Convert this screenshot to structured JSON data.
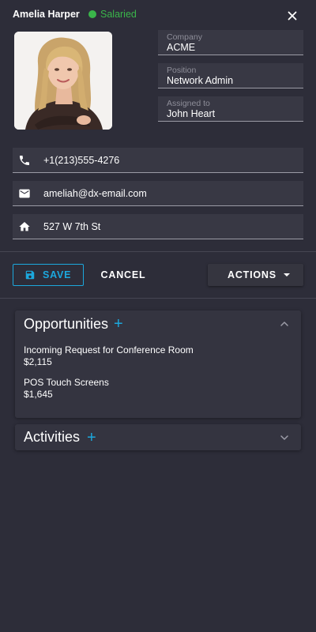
{
  "header": {
    "name": "Amelia Harper",
    "status": "Salaried",
    "status_color": "#3ab54a"
  },
  "photo": {
    "alt": "Amelia Harper photo"
  },
  "fields": {
    "company": {
      "label": "Company",
      "value": "ACME"
    },
    "position": {
      "label": "Position",
      "value": "Network Admin"
    },
    "assigned": {
      "label": "Assigned to",
      "value": "John Heart"
    }
  },
  "contacts": {
    "phone": {
      "icon": "phone-icon",
      "value": "+1(213)555-4276"
    },
    "email": {
      "icon": "email-icon",
      "value": "ameliah@dx-email.com"
    },
    "address": {
      "icon": "home-icon",
      "value": "527 W 7th St"
    }
  },
  "toolbar": {
    "save_label": "SAVE",
    "cancel_label": "CANCEL",
    "actions_label": "ACTIONS"
  },
  "opportunities": {
    "title": "Opportunities",
    "add": "+",
    "items": [
      {
        "name": "Incoming Request for Conference Room",
        "amount": "$2,115"
      },
      {
        "name": "POS Touch Screens",
        "amount": "$1,645"
      }
    ]
  },
  "activities": {
    "title": "Activities",
    "add": "+"
  },
  "colors": {
    "accent": "#1ca8dd",
    "background": "#2d2d39",
    "field_bg": "#383844",
    "status_green": "#3ab54a"
  }
}
